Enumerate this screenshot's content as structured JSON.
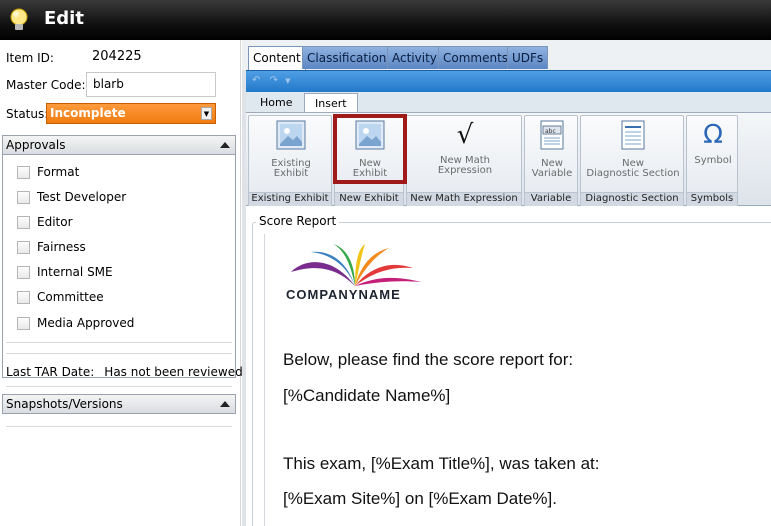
{
  "window": {
    "title": "Edit"
  },
  "left": {
    "item_id_label": "Item ID:",
    "item_id_value": "204225",
    "master_code_label": "Master Code:",
    "master_code_value": "blarb",
    "status_label": "Status:",
    "status_value": "Incomplete",
    "approvals_header": "Approvals",
    "approvals": [
      "Format",
      "Test Developer",
      "Editor",
      "Fairness",
      "Internal SME",
      "Committee",
      "Media Approved"
    ],
    "last_tar_label": "Last TAR Date:",
    "last_tar_value": "Has not been reviewed yet",
    "snapshots_header": "Snapshots/Versions"
  },
  "tabs": [
    "Content",
    "Classifications",
    "Activity",
    "Comments",
    "UDFs"
  ],
  "ribbon_tabs": [
    "Home",
    "Insert"
  ],
  "ribbon": {
    "existing_exhibit": {
      "line1": "Existing",
      "line2": "Exhibit",
      "group": "Existing Exhibit"
    },
    "new_exhibit": {
      "line1": "New",
      "line2": "Exhibit",
      "group": "New Exhibit"
    },
    "new_math": {
      "line1": "New Math",
      "line2": "Expression",
      "group": "New Math Expression"
    },
    "new_variable": {
      "line1": "New",
      "line2": "Variable",
      "group": "Variable"
    },
    "new_diag": {
      "line1": "New",
      "line2": "Diagnostic Section",
      "group": "Diagnostic Section"
    },
    "symbol": {
      "line1": "Symbol",
      "group": "Symbols"
    }
  },
  "content": {
    "section_label": "Score Report",
    "logo_text": "COMPANYNAME",
    "lines": [
      "Below, please find the score report for:",
      "[%Candidate Name%]",
      "This exam, [%Exam Title%], was taken at:",
      "[%Exam Site%] on [%Exam Date%]."
    ]
  },
  "colors": {
    "status_orange": "#f58220",
    "highlight_red": "#a01a1a",
    "ribbon_blue": "#2a7fd0"
  }
}
